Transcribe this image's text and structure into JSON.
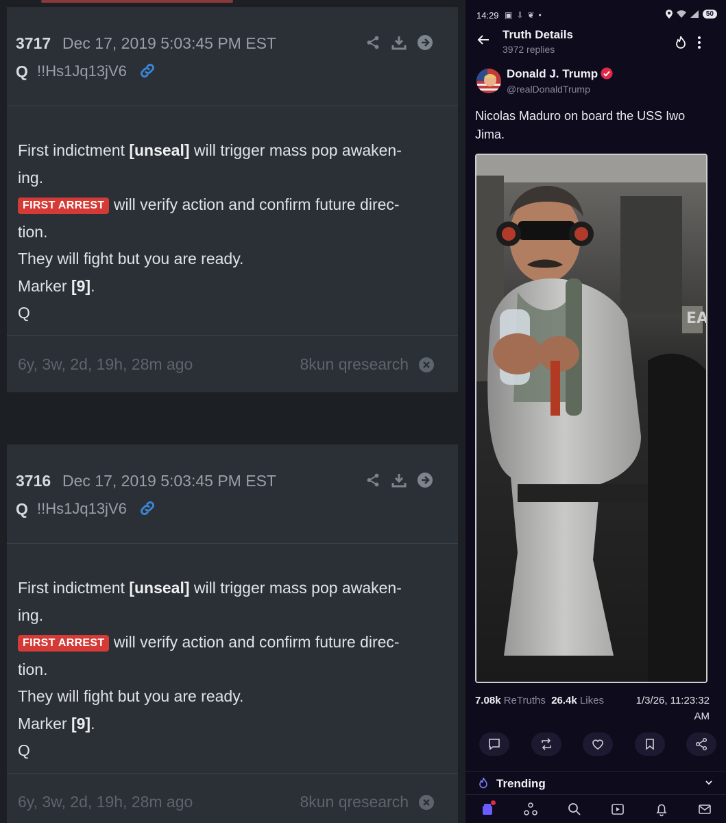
{
  "posts": [
    {
      "number": "3717",
      "date": "Dec 17, 2019 5:03:45 PM EST",
      "trip_q": "Q",
      "tripcode": "!!Hs1Jq13jV6",
      "line1_a": "First indictment ",
      "line1_b": "[unseal]",
      "line1_c": " will trigger mass pop awaken-",
      "line2": "ing.",
      "badge": "FIRST ARREST",
      "line3": " will verify action and confirm future direc-",
      "line4": "tion.",
      "line5": "They will fight but you are ready.",
      "line6_a": "Marker ",
      "line6_b": "[9]",
      "line6_c": ".",
      "line7": "Q",
      "ago": "6y, 3w, 2d, 19h, 28m ago",
      "source": "8kun qresearch"
    },
    {
      "number": "3716",
      "date": "Dec 17, 2019 5:03:45 PM EST",
      "trip_q": "Q",
      "tripcode": "!!Hs1Jq13jV6",
      "line1_a": "First indictment ",
      "line1_b": "[unseal]",
      "line1_c": " will trigger mass pop awaken-",
      "line2": "ing.",
      "badge": "FIRST ARREST",
      "line3": " will verify action and confirm future direc-",
      "line4": "tion.",
      "line5": "They will fight but you are ready.",
      "line6_a": "Marker ",
      "line6_b": "[9]",
      "line6_c": ".",
      "line7": "Q",
      "ago": "6y, 3w, 2d, 19h, 28m ago",
      "source": "8kun qresearch"
    }
  ],
  "phone": {
    "status_time": "14:29",
    "battery": "50",
    "title": "Truth Details",
    "subtitle": "3972 replies",
    "author_name": "Donald J. Trump",
    "author_handle": "@realDonaldTrump",
    "text": "Nicolas Maduro on board the USS Iwo Jima.",
    "retruths_count": "7.08k",
    "retruths_label": "ReTruths",
    "likes_count": "26.4k",
    "likes_label": "Likes",
    "timestamp": "1/3/26, 11:23:32 AM",
    "trending_label": "Trending"
  },
  "colors": {
    "badge": "#d43a36",
    "link": "#3a86d6",
    "verified": "#e0294a",
    "phone_bg": "#0e0b1c"
  }
}
